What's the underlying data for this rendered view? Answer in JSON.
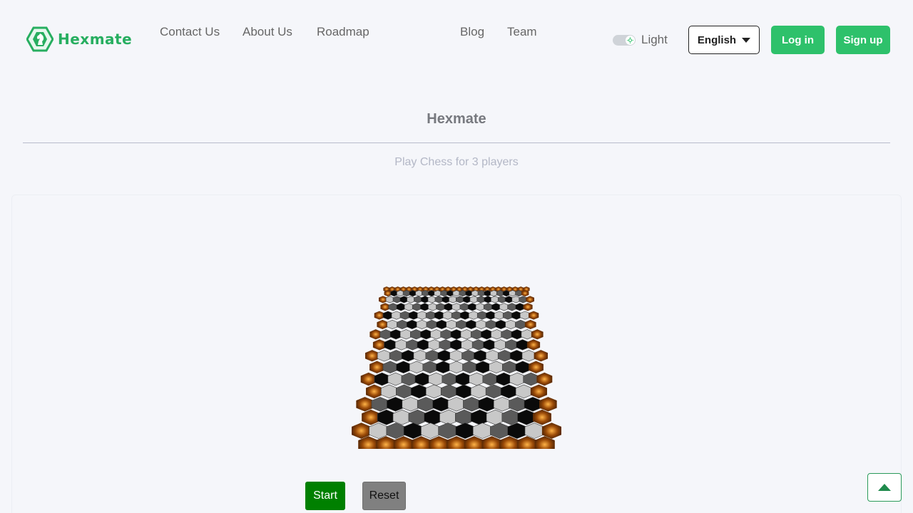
{
  "brand": {
    "name": "Hexmate",
    "color": "#27ae60"
  },
  "nav": {
    "links": [
      {
        "label": "Contact Us"
      },
      {
        "label": "About Us"
      },
      {
        "label": "Roadmap"
      },
      {
        "label": "Blog"
      },
      {
        "label": "Team"
      }
    ],
    "theme_toggle": {
      "label": "Light",
      "state": "light"
    },
    "language": {
      "selected": "English"
    },
    "login_label": "Log in",
    "signup_label": "Sign up"
  },
  "main": {
    "title": "Hexmate",
    "subtitle": "Play Chess for 3 players",
    "board": {
      "icon": "hexagonal-chess-board-3d"
    },
    "start_label": "Start",
    "reset_label": "Reset"
  },
  "colors": {
    "accent": "#2ec16b",
    "start": "#008000",
    "reset": "#808080",
    "board_border": "#9a4a08",
    "tile_light": "#c8c8c8",
    "tile_mid": "#5a5a5a",
    "tile_dark": "#0a0a0a"
  },
  "scroll_top": {
    "icon": "arrow-up-icon"
  }
}
